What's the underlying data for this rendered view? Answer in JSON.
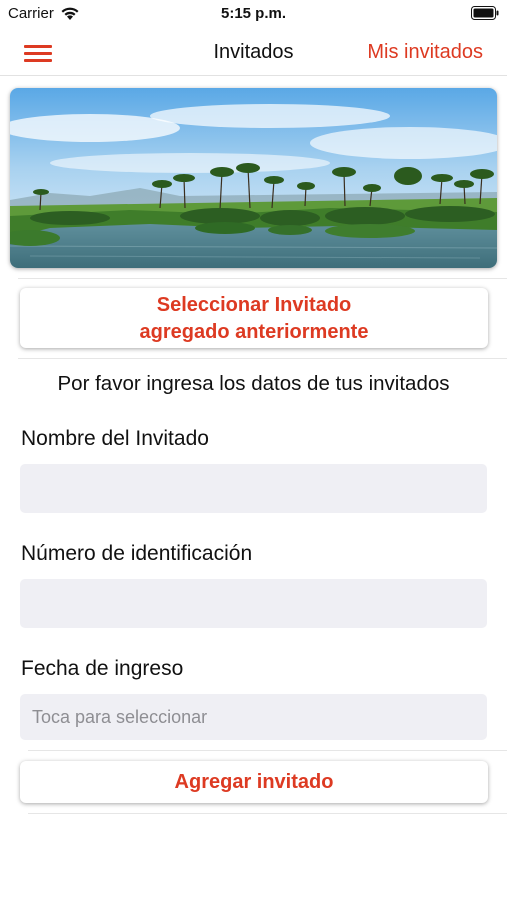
{
  "status_bar": {
    "carrier": "Carrier",
    "time": "5:15 p.m."
  },
  "nav": {
    "title": "Invitados",
    "right_action": "Mis invitados",
    "accent_color": "#dd3a22"
  },
  "hero": {
    "icon": "landscape-photo"
  },
  "select_button": {
    "line1": "Seleccionar Invitado",
    "line2": "agregado anteriormente"
  },
  "instructions": "Por favor ingresa los datos de tus invitados",
  "form": {
    "name_label": "Nombre del Invitado",
    "name_value": "",
    "id_label": "Número de identificación",
    "id_value": "",
    "date_label": "Fecha de ingreso",
    "date_placeholder": "Toca para seleccionar"
  },
  "add_button": "Agregar invitado"
}
